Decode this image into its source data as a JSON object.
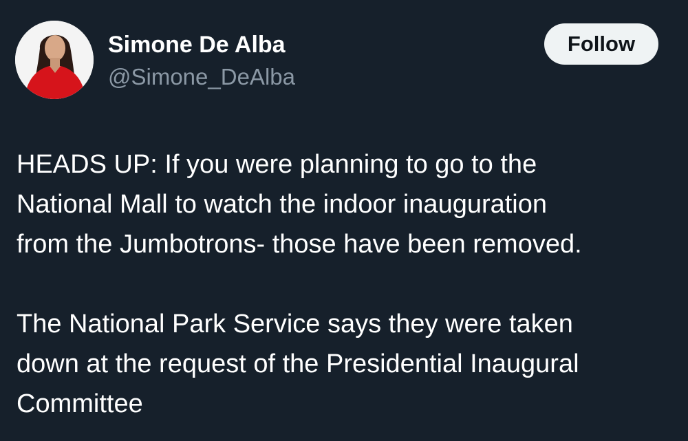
{
  "author": {
    "display_name": "Simone De Alba",
    "handle": "@Simone_DeAlba",
    "avatar_icon": "profile-photo"
  },
  "follow_button": {
    "label": "Follow"
  },
  "tweet": {
    "paragraphs": [
      {
        "lines": [
          "HEADS UP: If you were planning to go to the",
          "National Mall to watch the indoor inauguration",
          "from the Jumbotrons- those have been removed."
        ]
      },
      {
        "lines": [
          "The National Park Service says they were taken",
          "down at the request of the Presidential Inaugural",
          "Committee"
        ]
      }
    ]
  },
  "colors": {
    "background": "#16202b",
    "text_primary": "#ffffff",
    "text_secondary": "#8b98a5",
    "button_bg": "#eff3f4",
    "button_text": "#0f1419"
  }
}
